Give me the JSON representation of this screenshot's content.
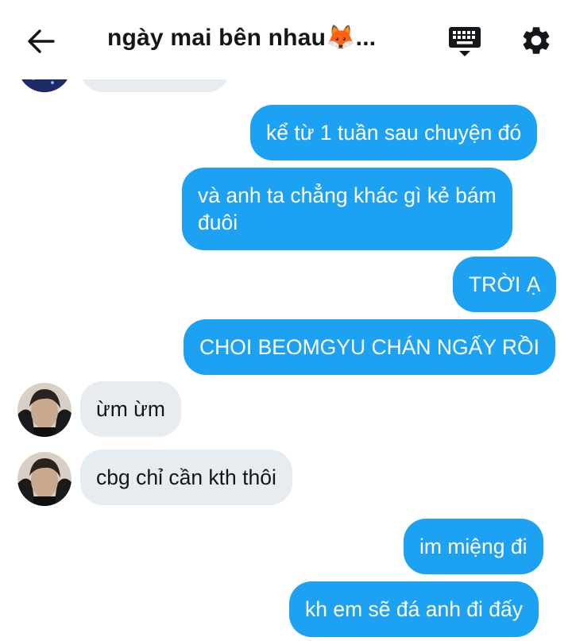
{
  "header": {
    "title": "ngày mai bên nhau🦊...",
    "back_icon": "arrow-left-icon",
    "keyboard_icon": "keyboard-icon",
    "settings_icon": "gear-icon"
  },
  "messages": [
    {
      "from": "me",
      "text": "kể từ 1 tuần sau chuyện đó"
    },
    {
      "from": "me",
      "text_line1": "và anh ta chẳng khác gì kẻ bám",
      "text_line2": "đuôi"
    },
    {
      "from": "me",
      "text": "TRỜI Ạ"
    },
    {
      "from": "me",
      "text": "CHOI BEOMGYU CHÁN NGẤY RỒI"
    },
    {
      "from": "them",
      "text": "ừm ừm"
    },
    {
      "from": "them",
      "text": "cbg chỉ cần kth thôi"
    },
    {
      "from": "me",
      "text": "im miệng đi"
    },
    {
      "from": "me",
      "text": "kh em sẽ đá anh đi đấy"
    }
  ],
  "colors": {
    "outgoing_bubble": "#1da1f2",
    "incoming_bubble": "#e6ecf0",
    "text_dark": "#14171a"
  }
}
